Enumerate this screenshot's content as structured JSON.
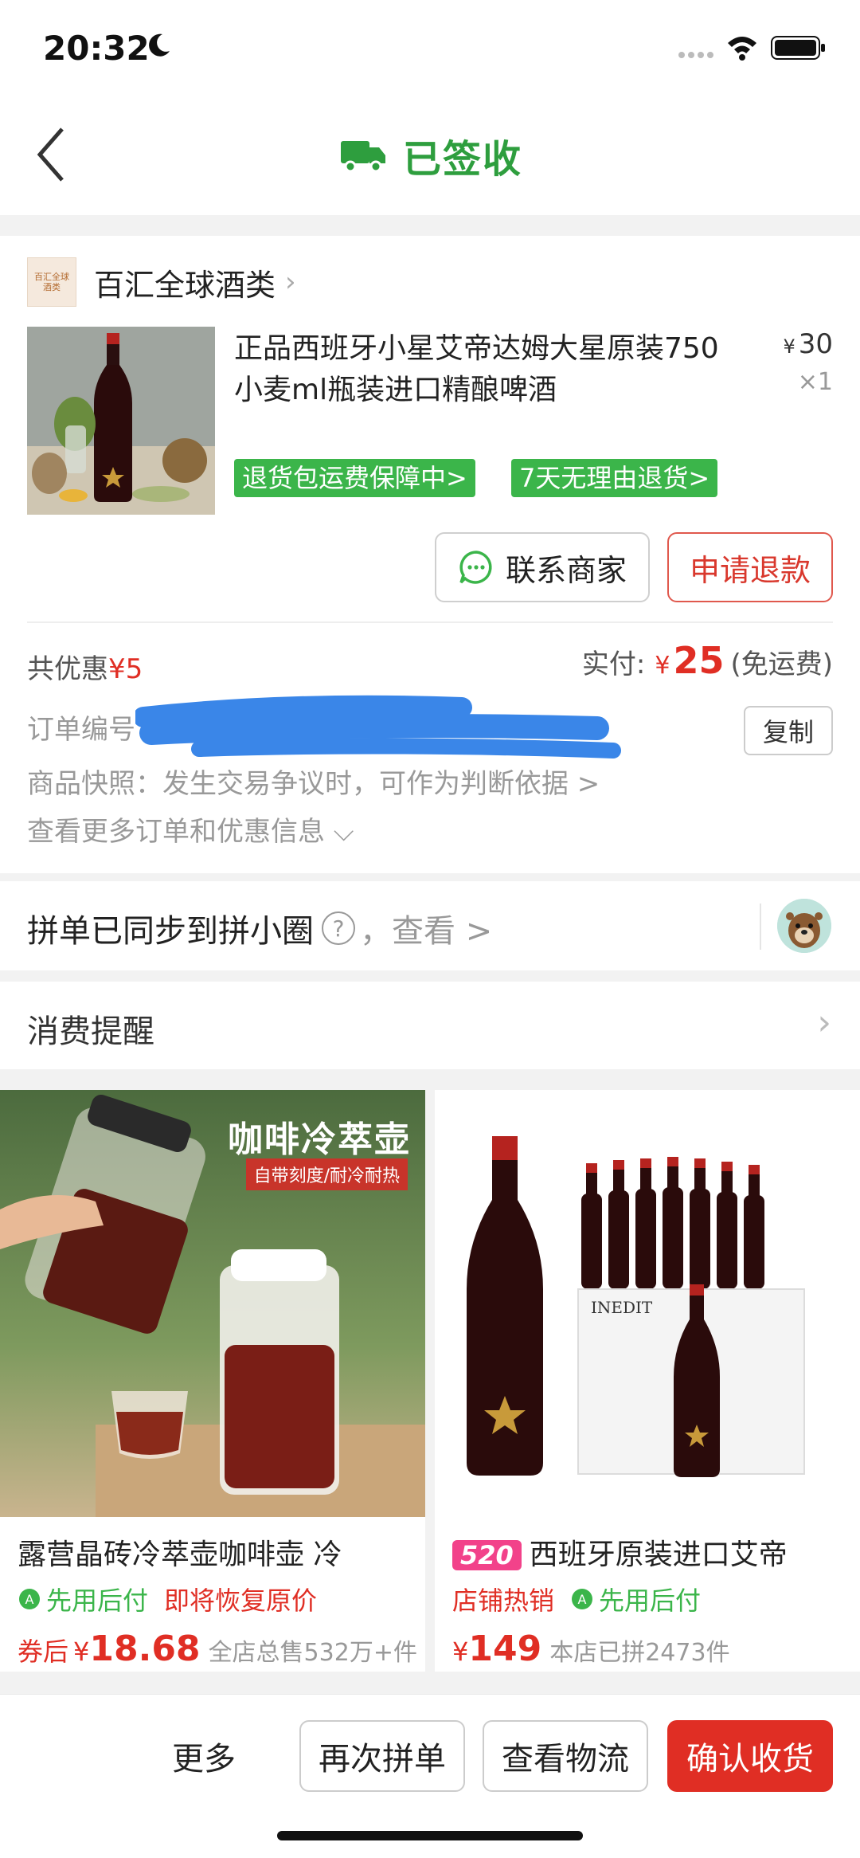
{
  "status_bar": {
    "time": "20:32"
  },
  "nav": {
    "title": "已签收"
  },
  "shop": {
    "name": "百汇全球酒类",
    "logo_text": "百汇全球酒类"
  },
  "product": {
    "title": "正品西班牙小星艾帝达姆大星原装750小麦ml瓶装进口精酿啤酒",
    "price_symbol": "¥",
    "price": "30",
    "qty": "×1",
    "tags": [
      "退货包运费保障中>",
      "7天无理由退货>"
    ]
  },
  "actions": {
    "contact": "联系商家",
    "refund": "申请退款"
  },
  "summary": {
    "discount_label": "共优惠",
    "discount_value": "¥5",
    "paid_label": "实付:",
    "paid_symbol": "¥",
    "paid_amount": "25",
    "paid_note": "(免运费)",
    "order_no_label": "订单编号",
    "copy": "复制",
    "snapshot": "商品快照：发生交易争议时，可作为判断依据 >",
    "more": "查看更多订单和优惠信息 ⌵"
  },
  "sync": {
    "text": "拼单已同步到拼小圈",
    "help": "?",
    "view": "，查看 >"
  },
  "reminder": {
    "label": "消费提醒",
    "chevron": "›"
  },
  "recommendations": [
    {
      "image_title": "咖啡冷萃壶",
      "image_subtitle": "自带刻度/耐冷耐热",
      "title": "露营晶砖冷萃壶咖啡壶 冷",
      "badge_green": "先用后付",
      "badge_red": "即将恢复原价",
      "price_prefix": "券后",
      "price_symbol": "¥",
      "price": "18.68",
      "sales": "全店总售532万+件"
    },
    {
      "badge": "520",
      "title": "西班牙原装进口艾帝",
      "badge_red": "店铺热销",
      "badge_green": "先用后付",
      "price_symbol": "¥",
      "price": "149",
      "sales": "本店已拼2473件",
      "box_text": "INEDIT"
    }
  ],
  "bottom_bar": {
    "more": "更多",
    "again": "再次拼单",
    "logistics": "查看物流",
    "confirm": "确认收货"
  },
  "colors": {
    "accent_red": "#e02e24",
    "accent_green": "#2e9e3e",
    "tag_green": "#3bb54a",
    "redaction_blue": "#3a86e8"
  }
}
